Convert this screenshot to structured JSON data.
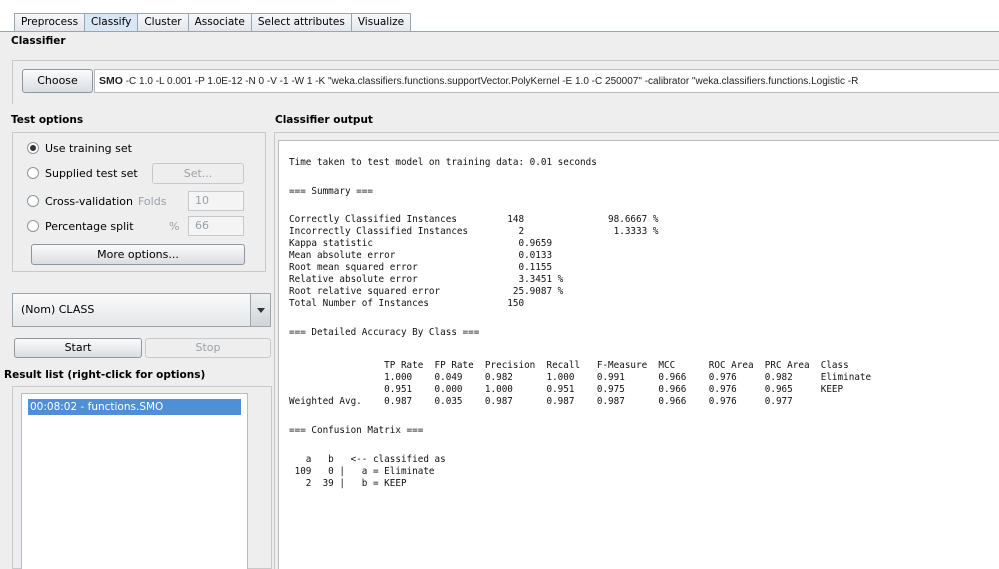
{
  "tabs": [
    "Preprocess",
    "Classify",
    "Cluster",
    "Associate",
    "Select attributes",
    "Visualize"
  ],
  "classifier": {
    "title": "Classifier",
    "choose_label": "Choose",
    "algorithm": "SMO",
    "options": " -C 1.0 -L 0.001 -P 1.0E-12 -N 0 -V -1 -W 1 -K \"weka.classifiers.functions.supportVector.PolyKernel -E 1.0 -C 250007\" -calibrator \"weka.classifiers.functions.Logistic -R"
  },
  "test_options": {
    "title": "Test options",
    "use_training": "Use training set",
    "supplied_test": "Supplied test set",
    "set_button": "Set...",
    "cross_validation": "Cross-validation",
    "folds_label": "Folds",
    "folds_value": "10",
    "percentage_split": "Percentage split",
    "percent_label": "%",
    "percent_value": "66",
    "more_options": "More options...",
    "selected": "Use training set"
  },
  "class_selector": {
    "value": "(Nom) CLASS"
  },
  "actions": {
    "start": "Start",
    "stop": "Stop"
  },
  "result_list": {
    "title": "Result list (right-click for options)",
    "items": [
      "00:08:02 - functions.SMO"
    ]
  },
  "output": {
    "title": "Classifier output",
    "lines": [
      "Time taken to test model on training data: 0.01 seconds",
      "",
      "=== Summary ===",
      "",
      "Correctly Classified Instances         148               98.6667 %",
      "Incorrectly Classified Instances         2                1.3333 %",
      "Kappa statistic                          0.9659",
      "Mean absolute error                      0.0133",
      "Root mean squared error                  0.1155",
      "Relative absolute error                  3.3451 %",
      "Root relative squared error             25.9087 %",
      "Total Number of Instances              150",
      "",
      "=== Detailed Accuracy By Class ===",
      "",
      "                 TP Rate  FP Rate  Precision  Recall   F-Measure  MCC      ROC Area  PRC Area  Class",
      "                 1.000    0.049    0.982      1.000    0.991      0.966    0.976     0.982     Eliminate",
      "                 0.951    0.000    1.000      0.951    0.975      0.966    0.976     0.965     KEEP",
      "Weighted Avg.    0.987    0.035    0.987      0.987    0.987      0.966    0.976     0.977",
      "",
      "=== Confusion Matrix ===",
      "",
      "   a   b   <-- classified as",
      " 109   0 |   a = Eliminate",
      "   2  39 |   b = KEEP"
    ]
  }
}
